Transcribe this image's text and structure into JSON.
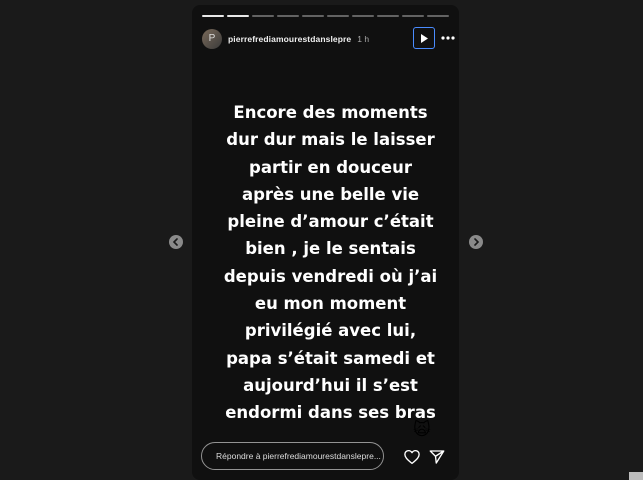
{
  "story": {
    "progress_segments_total": 10,
    "progress_segments_done": 2,
    "username": "pierrefrediamourestdanslepre",
    "time": "1 h",
    "avatar_initials": "P",
    "lines": [
      "Encore des moments",
      "dur dur mais  le laisser",
      "partir en douceur",
      "après une belle vie",
      "pleine d’amour c’était",
      "bien , je le sentais",
      "depuis vendredi où j’ai",
      "eu mon moment",
      "privilégié avec lui,",
      "papa s’était samedi et",
      "aujourd’hui il s’est",
      "endormi dans ses bras"
    ],
    "emoji": "🙀"
  },
  "reply": {
    "placeholder": "Répondre à pierrefrediamourestdanslepre..."
  },
  "icons": {
    "play": "play-icon",
    "more": "more-icon",
    "heart": "heart-icon",
    "send": "send-icon",
    "prev": "chevron-left-icon",
    "next": "chevron-right-icon"
  },
  "colors": {
    "background": "#1a1a1a",
    "story_bg": "#101010",
    "accent": "#4a8cff",
    "text": "#ffffff"
  }
}
